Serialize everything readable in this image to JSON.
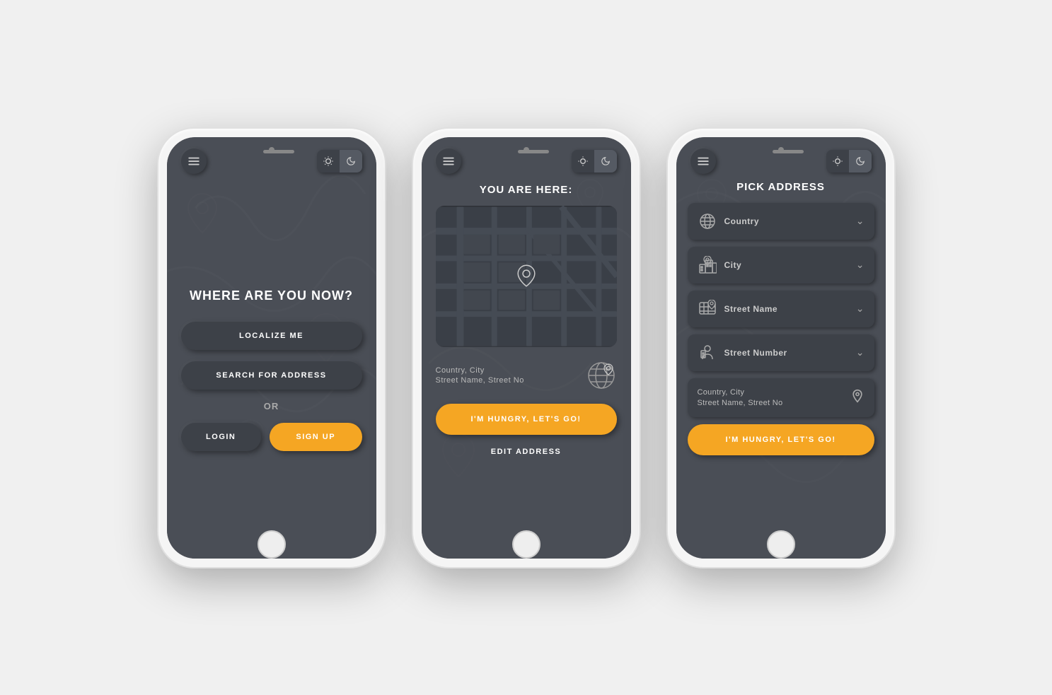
{
  "phones": [
    {
      "id": "phone1",
      "screen": "location-choice",
      "title": "WHERE ARE YOU NOW?",
      "buttons": {
        "localize": "LOCALIZE ME",
        "search": "SEARCH FOR ADDRESS",
        "or": "OR",
        "login": "LOGIN",
        "signup": "SIGN UP"
      },
      "theme": {
        "sun": "☀",
        "moon": "🌙",
        "active": "moon"
      }
    },
    {
      "id": "phone2",
      "screen": "map-view",
      "title": "YOU ARE HERE:",
      "address": {
        "line1": "Country, City",
        "line2": "Street Name, Street No"
      },
      "buttons": {
        "hungry": "I'M HUNGRY, LET'S GO!",
        "edit": "EDIT ADDRESS"
      },
      "theme": {
        "sun": "☀",
        "moon": "🌙",
        "active": "moon"
      }
    },
    {
      "id": "phone3",
      "screen": "pick-address",
      "title": "PICK ADDRESS",
      "fields": [
        {
          "id": "country",
          "label": "Country",
          "icon": "globe"
        },
        {
          "id": "city",
          "label": "City",
          "icon": "city"
        },
        {
          "id": "street-name",
          "label": "Street Name",
          "icon": "street"
        },
        {
          "id": "street-number",
          "label": "Street Number",
          "icon": "building"
        }
      ],
      "summary": {
        "line1": "Country, City",
        "line2": "Street Name, Street No"
      },
      "buttons": {
        "hungry": "I'M HUNGRY, LET'S GO!"
      },
      "theme": {
        "sun": "☀",
        "moon": "🌙",
        "active": "moon"
      }
    }
  ],
  "colors": {
    "accent": "#f5a623",
    "bg_screen": "#4a4e56",
    "bg_card": "#3d4148",
    "text_primary": "#ffffff",
    "text_secondary": "#bbbbbb"
  }
}
